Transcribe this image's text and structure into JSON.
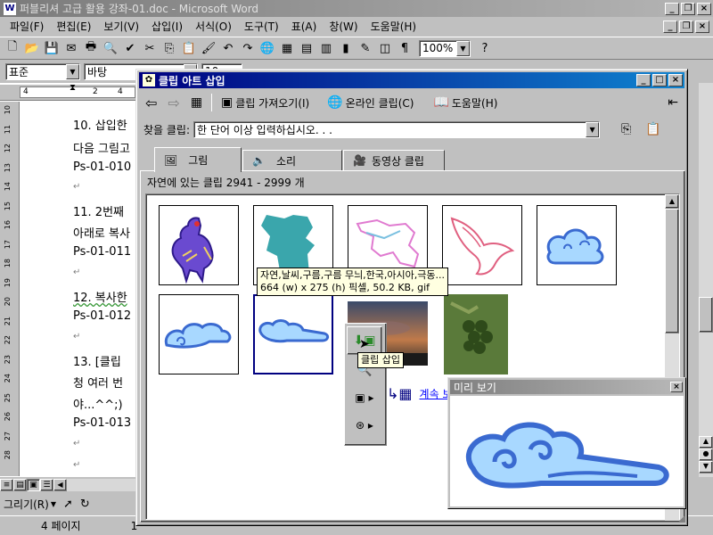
{
  "app": {
    "title": "퍼블리셔 고급 활용 강좌-01.doc - Microsoft Word",
    "menu": [
      "파일(F)",
      "편집(E)",
      "보기(V)",
      "삽입(I)",
      "서식(O)",
      "도구(T)",
      "표(A)",
      "창(W)",
      "도움말(H)"
    ],
    "zoom": "100%",
    "style_value": "표준",
    "font_value": "바탕",
    "font_size": "10",
    "draw_label": "그리기(R)",
    "status_page": "4 페이지",
    "status_page_2": "1"
  },
  "document": {
    "lines": [
      "10. 삽입한",
      "다음 그림고",
      "Ps-01-010",
      "↵",
      "11. 2번째 ",
      "아래로 복사",
      "Ps-01-011",
      "↵",
      "12. 복사한",
      "Ps-01-012",
      "↵",
      "13. [클립 ",
      "청 여러 번",
      "야...^^;)",
      "Ps-01-013",
      "↵",
      "↵"
    ],
    "ruler_numbers": [
      "10",
      "11",
      "12",
      "13",
      "14",
      "15",
      "16",
      "17",
      "18",
      "19",
      "20",
      "21",
      "22",
      "23",
      "24",
      "25",
      "26",
      "27",
      "28"
    ]
  },
  "dialog": {
    "title": "클립 아트 삽입",
    "toolbar": {
      "import_label": "클립 가져오기(I)",
      "online_label": "온라인 클립(C)",
      "help_label": "도움말(H)"
    },
    "find_label": "찾을 클립:",
    "find_placeholder": "한 단어 이상 입력하십시오. . .",
    "tabs": [
      "그림",
      "소리",
      "동영상 클립"
    ],
    "header": "자연에 있는 클립 2941 - 2999 개",
    "tooltip_line1": "자연,날씨,구름,구름 무늬,한국,아시아,극동...",
    "tooltip_line2": "664 (w) x 275 (h) 픽셀, 50.2 KB, gif",
    "menu_tooltip": "클립 삽입",
    "more_link": "계속 보기"
  },
  "preview": {
    "title": "미리 보기"
  }
}
